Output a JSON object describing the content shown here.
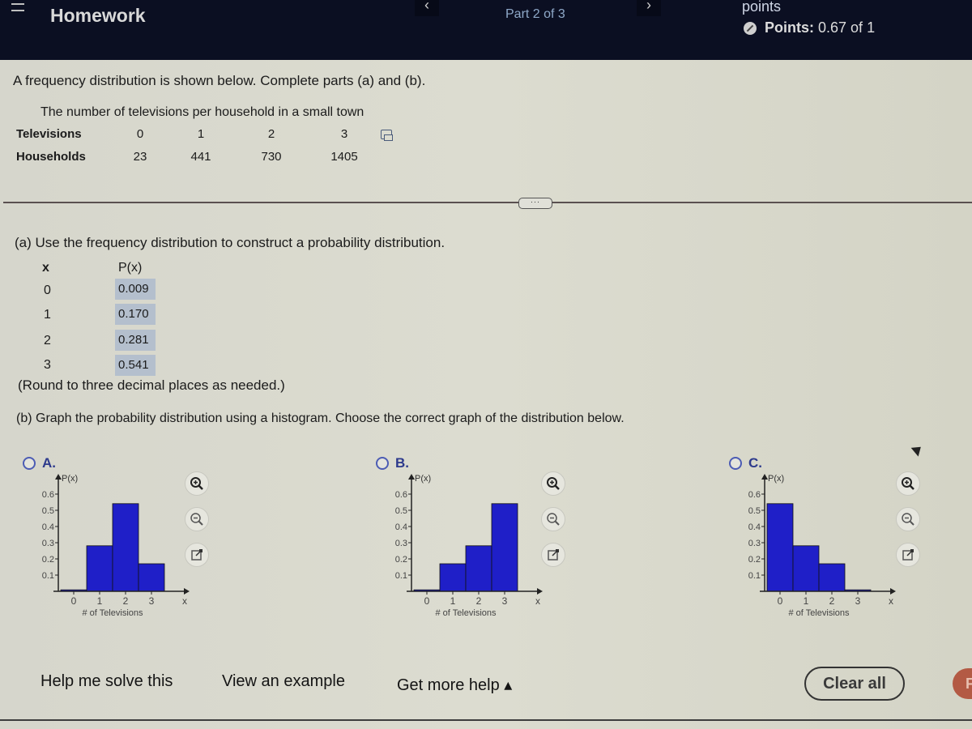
{
  "header": {
    "title": "Homework",
    "part_label": "Part 2 of 3",
    "points_word": "points",
    "points_label": "Points:",
    "points_value": "0.67 of 1",
    "prev_arrow": "‹",
    "next_arrow": "›"
  },
  "question": {
    "intro": "A frequency distribution is shown below. Complete parts (a) and (b).",
    "table_caption": "The number of televisions per household in a small town",
    "row1_header": "Televisions",
    "row1_values": [
      "0",
      "1",
      "2",
      "3"
    ],
    "row2_header": "Households",
    "row2_values": [
      "23",
      "441",
      "730",
      "1405"
    ]
  },
  "part_a": {
    "prompt": "(a) Use the frequency distribution to construct a probability distribution.",
    "col_x": "x",
    "col_px": "P(x)",
    "rows": [
      {
        "x": "0",
        "px": "0.009"
      },
      {
        "x": "1",
        "px": "0.170"
      },
      {
        "x": "2",
        "px": "0.281"
      },
      {
        "x": "3",
        "px": "0.541"
      }
    ],
    "note": "(Round to three decimal places as needed.)"
  },
  "part_b": {
    "prompt": "(b) Graph the probability distribution using a histogram. Choose the correct graph of the distribution below."
  },
  "chart_data": [
    {
      "type": "bar",
      "option": "A.",
      "title": "",
      "xlabel": "# of Televisions",
      "ylabel": "P(x)",
      "x_axis_letter": "x",
      "categories": [
        "0",
        "1",
        "2",
        "3"
      ],
      "values": [
        0.009,
        0.281,
        0.541,
        0.17
      ],
      "yticks": [
        "0.1",
        "0.2",
        "0.3",
        "0.4",
        "0.5",
        "0.6"
      ],
      "ylim": [
        0,
        0.65
      ]
    },
    {
      "type": "bar",
      "option": "B.",
      "title": "",
      "xlabel": "# of Televisions",
      "ylabel": "P(x)",
      "x_axis_letter": "x",
      "categories": [
        "0",
        "1",
        "2",
        "3"
      ],
      "values": [
        0.009,
        0.17,
        0.281,
        0.541
      ],
      "yticks": [
        "0.1",
        "0.2",
        "0.3",
        "0.4",
        "0.5",
        "0.6"
      ],
      "ylim": [
        0,
        0.65
      ]
    },
    {
      "type": "bar",
      "option": "C.",
      "title": "",
      "xlabel": "# of Televisions",
      "ylabel": "P(x)",
      "x_axis_letter": "x",
      "categories": [
        "0",
        "1",
        "2",
        "3"
      ],
      "values": [
        0.541,
        0.281,
        0.17,
        0.009
      ],
      "yticks": [
        "0.1",
        "0.2",
        "0.3",
        "0.4",
        "0.5",
        "0.6"
      ],
      "ylim": [
        0,
        0.65
      ]
    }
  ],
  "colors": {
    "bar_fill": "#1f1fc8",
    "header_bg": "#0b0f22",
    "answer_bg": "#b4bfcd",
    "radio_accent": "#4c5cb4"
  },
  "bottom": {
    "help_solve": "Help me solve this",
    "view_example": "View an example",
    "more_help": "Get more help ▴",
    "clear_all": "Clear all",
    "final": "Fi"
  },
  "divider_handle": "···"
}
